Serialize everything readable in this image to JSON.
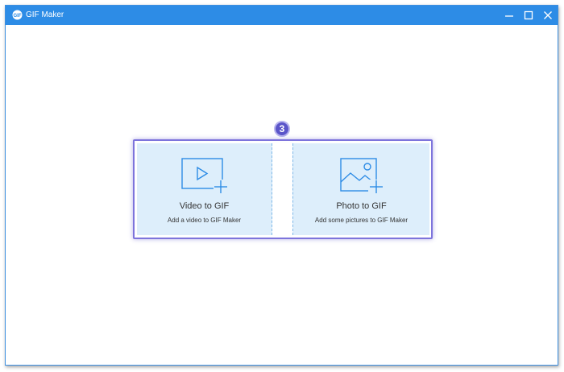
{
  "window": {
    "title": "GIF Maker"
  },
  "step_badge": "3",
  "cards": [
    {
      "title": "Video to GIF",
      "subtitle": "Add a video to GIF Maker",
      "icon": "video-add-icon"
    },
    {
      "title": "Photo to GIF",
      "subtitle": "Add some pictures to GIF Maker",
      "icon": "photo-add-icon"
    }
  ],
  "colors": {
    "titlebar": "#2d8ce6",
    "card_bg": "#ddeefb",
    "accent": "#2d8ce6",
    "highlight_border": "#7d74dc",
    "badge": "#5b55c9"
  }
}
